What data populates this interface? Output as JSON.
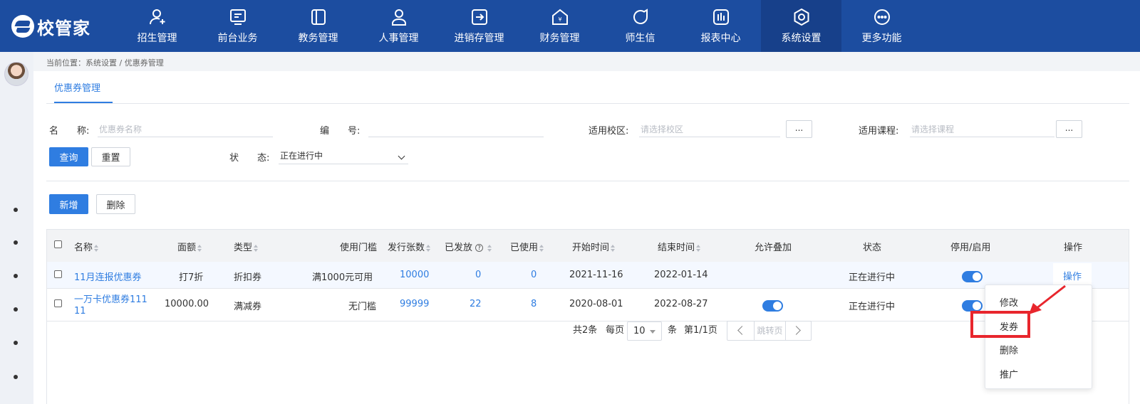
{
  "app": {
    "logo_text": "校管家"
  },
  "nav": [
    {
      "label": "招生管理",
      "icon": "user-plus-icon"
    },
    {
      "label": "前台业务",
      "icon": "monitor-icon"
    },
    {
      "label": "教务管理",
      "icon": "book-icon"
    },
    {
      "label": "人事管理",
      "icon": "person-icon"
    },
    {
      "label": "进销存管理",
      "icon": "box-arrow-icon"
    },
    {
      "label": "财务管理",
      "icon": "money-house-icon"
    },
    {
      "label": "师生信",
      "icon": "chat-icon"
    },
    {
      "label": "报表中心",
      "icon": "chart-icon"
    },
    {
      "label": "系统设置",
      "icon": "gear-icon",
      "active": true
    },
    {
      "label": "更多功能",
      "icon": "more-icon"
    }
  ],
  "breadcrumb": "当前位置：系统设置 / 优惠券管理",
  "tab": {
    "label": "优惠券管理"
  },
  "filters": {
    "name_label": "名　　称:",
    "name_placeholder": "优惠券名称",
    "code_label": "编　　号:",
    "campus_label": "适用校区:",
    "campus_placeholder": "请选择校区",
    "course_label": "适用课程:",
    "course_placeholder": "请选择课程",
    "dots": "...",
    "status_label": "状　　态:",
    "status_value": "正在进行中",
    "query_btn": "查询",
    "reset_btn": "重置"
  },
  "toolbar": {
    "add_btn": "新增",
    "delete_btn": "删除"
  },
  "table": {
    "columns": {
      "name": "名称",
      "face": "面额",
      "type": "类型",
      "threshold": "使用门槛",
      "issued": "发行张数",
      "sent": "已发放",
      "help": "?",
      "used": "已使用",
      "start": "开始时间",
      "end": "结束时间",
      "stack": "允许叠加",
      "status": "状态",
      "enable": "停用/启用",
      "action": "操作"
    },
    "rows": [
      {
        "name": "11月连报优惠券",
        "face": "打7折",
        "type": "折扣券",
        "threshold": "满1000元可用",
        "issued": "10000",
        "sent": "0",
        "used": "0",
        "start": "2021-11-16",
        "end": "2022-01-14",
        "stack": false,
        "status": "正在进行中",
        "enabled": true,
        "action": "操作"
      },
      {
        "name_line1": "一万卡优惠券111",
        "name_line2": "11",
        "face": "10000.00",
        "type": "满减券",
        "threshold": "无门槛",
        "issued": "99999",
        "sent": "22",
        "used": "8",
        "start": "2020-08-01",
        "end": "2022-08-27",
        "stack": true,
        "status": "正在进行中",
        "enabled": true
      }
    ]
  },
  "pagination": {
    "total": "共2条",
    "per_page_label": "每页",
    "per_page": "10",
    "unit": "条",
    "page_info": "第1/1页",
    "jump": "跳转页"
  },
  "dropdown": {
    "items": [
      "修改",
      "发券",
      "删除",
      "推广"
    ],
    "highlighted": "发券"
  },
  "colors": {
    "nav_bg": "#1c4da0",
    "primary": "#2f7de1",
    "highlight": "#e8262d"
  }
}
